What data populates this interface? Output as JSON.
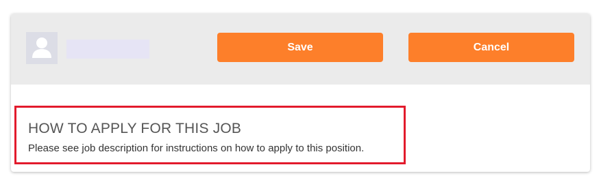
{
  "header": {
    "avatar_icon": "user-silhouette-icon",
    "save_label": "Save",
    "cancel_label": "Cancel"
  },
  "apply": {
    "title": "HOW TO APPLY FOR THIS JOB",
    "text": "Please see job description for instructions on how to apply to this position."
  },
  "colors": {
    "button": "#fd7f2a",
    "header_bg": "#ebebeb",
    "highlight_border": "#e21b2c",
    "name_placeholder": "#e6e4f5"
  }
}
